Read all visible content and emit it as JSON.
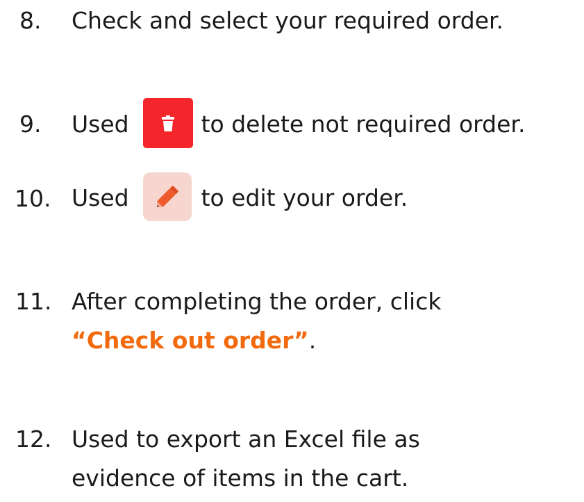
{
  "steps": [
    {
      "number": "8.",
      "text": "Check and select your required order."
    },
    {
      "number": "9.",
      "text_before": "Used",
      "text_after": "to delete not required order.",
      "icon": "trash-icon",
      "icon_bg": "#f4262b"
    },
    {
      "number": "10.",
      "text_before": "Used",
      "text_after": "to edit your order.",
      "icon": "pencil-icon",
      "icon_bg": "#f6d6ce"
    },
    {
      "number": "11.",
      "line1": "After completing the order, click",
      "highlight": "“Check out order”",
      "after_highlight": ".",
      "highlight_color": "#f26a0e"
    },
    {
      "number": "12.",
      "line1": "Used to export an Excel file as",
      "line2": "evidence of items in the cart."
    }
  ]
}
